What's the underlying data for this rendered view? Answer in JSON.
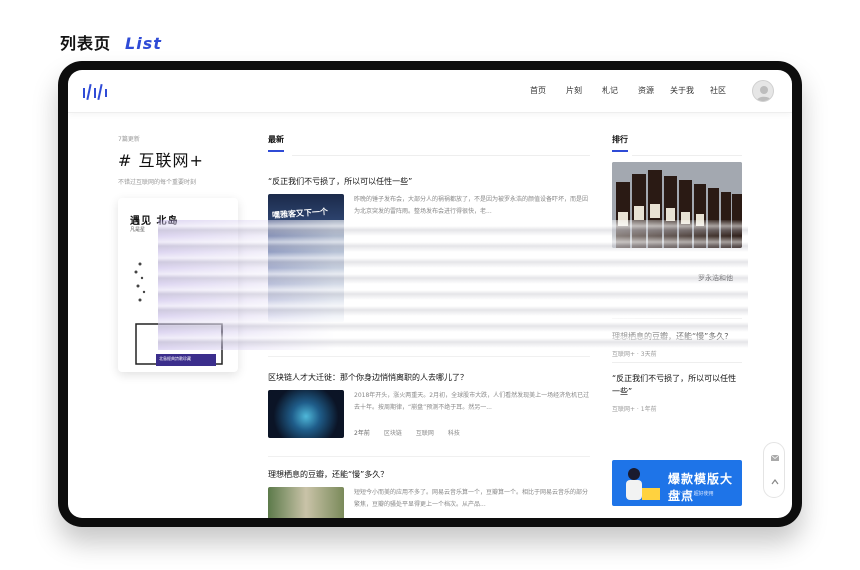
{
  "heading": {
    "cn": "列表页",
    "en": "List"
  },
  "nav": {
    "items": [
      "首页",
      "片刻",
      "札记",
      "资源",
      "关于我",
      "社区"
    ]
  },
  "topic": {
    "meta": "7篇更新",
    "title": "# 互联网+",
    "desc": "不错过互联网的每个重要时刻"
  },
  "book": {
    "title": "遇见 北岛",
    "sub": "凡是星",
    "banner": "北島經典詩歌珍藏"
  },
  "latest": {
    "title": "最新",
    "articles": [
      {
        "title": "“反正我们不亏损了，所以可以任性一些”",
        "body": "昨晚的锤子发布会，大部分人的祸祸都放了，不是因为被罗永浩的颜值设备吓坏，而是因为北京突发的雷阵雨。整场发布会进行得很快，老...",
        "thumb_text": "嘿雅客又下一个"
      },
      {
        "title": "区块链人才大迁徙：那个你身边悄悄离职的人去哪儿了？",
        "body": "2018年开头，涨火两重天。2月初，全球股市大跌，人们看然发现美上一场经济危机已过去十年。按周期律，“崩盘”预测不绝于耳。然另一...",
        "tags": [
          "2年前",
          "区块链",
          "互联网",
          "科技"
        ]
      },
      {
        "title": "理想栖息的豆瓣，还能“慢”多久？",
        "body": "短短今小而美的应用不多了。网易云音乐算一个，豆瓣算一个。相比于网易云音乐的部分繁焦，豆瓣的骚处平显得更上一个档次。从产品..."
      }
    ]
  },
  "ranking": {
    "title": "排行",
    "img_caption": "罗永浩和他",
    "items": [
      {
        "title": "理想栖息的豆瓣，还能“慢”多久?",
        "meta": "互联网+ · 3天前"
      },
      {
        "title": "“反正我们不亏损了，所以可以任性一些”",
        "meta": "互联网+ · 1年前"
      }
    ],
    "promo": {
      "title": "爆款模版大盘点",
      "sub": "三个模版 超好使用"
    }
  },
  "colors": {
    "accent": "#2f4bd6",
    "promo": "#1e74e8"
  }
}
